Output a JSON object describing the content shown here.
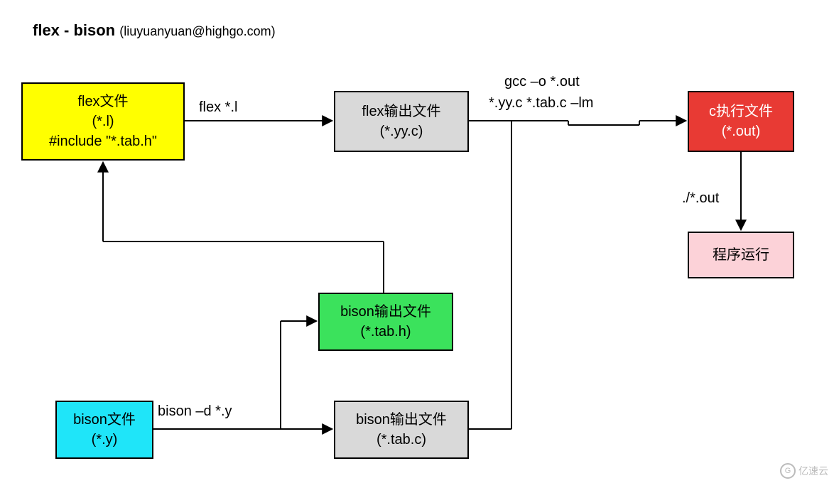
{
  "title": {
    "main": "flex - bison",
    "sub": "(liuyuanyuan@highgo.com)"
  },
  "boxes": {
    "flex_file": {
      "line1": "flex文件",
      "line2": "(*.l)",
      "line3": "#include \"*.tab.h\""
    },
    "flex_out": {
      "line1": "flex输出文件",
      "line2": "(*.yy.c)"
    },
    "c_exec": {
      "line1": "c执行文件",
      "line2": "(*.out)"
    },
    "run": {
      "line1": "程序运行"
    },
    "bison_outh": {
      "line1": "bison输出文件",
      "line2": "(*.tab.h)"
    },
    "bison_outc": {
      "line1": "bison输出文件",
      "line2": "(*.tab.c)"
    },
    "bison_file": {
      "line1": "bison文件",
      "line2": "(*.y)"
    }
  },
  "edges": {
    "flex_cmd": "flex *.l",
    "gcc_line1": "gcc –o *.out",
    "gcc_line2": "*.yy.c  *.tab.c –lm",
    "run_cmd": "./*.out",
    "bison_cmd": "bison –d *.y"
  },
  "watermark": "亿速云"
}
